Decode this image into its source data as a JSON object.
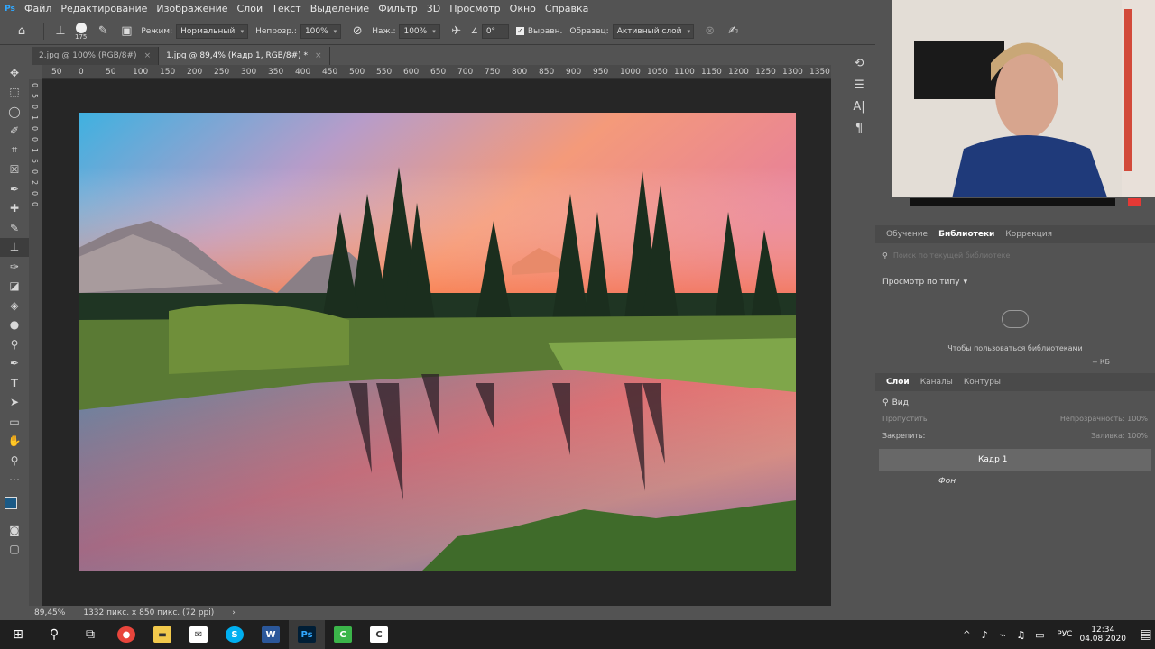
{
  "menubar": {
    "logo": "Ps",
    "items": [
      "Файл",
      "Редактирование",
      "Изображение",
      "Слои",
      "Текст",
      "Выделение",
      "Фильтр",
      "3D",
      "Просмотр",
      "Окно",
      "Справка"
    ]
  },
  "options": {
    "brush_size": "175",
    "mode_label": "Режим:",
    "mode_value": "Нормальный",
    "opacity_label": "Непрозр.:",
    "opacity_value": "100%",
    "pressure_label": "Наж.:",
    "pressure_value": "100%",
    "angle_value": "0°",
    "align_label": "Выравн.",
    "sample_label": "Образец:",
    "sample_value": "Активный слой"
  },
  "tabs": [
    {
      "label": "2.jpg @ 100% (RGB/8#)",
      "close": "×"
    },
    {
      "label": "1.jpg @ 89,4% (Кадр 1, RGB/8#) *",
      "close": "×"
    }
  ],
  "ruler_h": [
    "50",
    "0",
    "50",
    "100",
    "150",
    "200",
    "250",
    "300",
    "350",
    "400",
    "450",
    "500",
    "550",
    "600",
    "650",
    "700",
    "750",
    "800",
    "850",
    "900",
    "950",
    "1000",
    "1050",
    "1100",
    "1150",
    "1200",
    "1250",
    "1300",
    "1350"
  ],
  "ruler_v": [
    "0",
    "5",
    "0",
    "1",
    "0",
    "0",
    "1",
    "5",
    "0",
    "2",
    "0",
    "0"
  ],
  "status": {
    "zoom": "89,45%",
    "size": "1332 пикс. x 850 пикс. (72 ppi)",
    "arrow": "›"
  },
  "libraries": {
    "tabs": [
      "Обучение",
      "Библиотеки",
      "Коррекция"
    ],
    "search_placeholder": "Поиск по текущей библиотеке",
    "browse_label": "Просмотр по типу",
    "empty_message": "Чтобы пользоваться библиотеками",
    "size_label": "-- КБ"
  },
  "layers": {
    "tabs": [
      "Слои",
      "Каналы",
      "Контуры"
    ],
    "filter_label": "Вид",
    "blend_value": "Пропустить",
    "opacity_label": "Непрозрачность:",
    "opacity_value": "100%",
    "lock_label": "Закрепить:",
    "fill_label": "Заливка:",
    "fill_value": "100%",
    "items": [
      {
        "name": "Кадр 1"
      },
      {
        "name": "Фон"
      }
    ]
  },
  "taskbar": {
    "lang": "РУС",
    "time": "12:34",
    "date": "04.08.2020"
  },
  "colors": {
    "ps_blue": "#31a8ff",
    "canvas_bg": "#262626",
    "ui_bg": "#535353"
  }
}
